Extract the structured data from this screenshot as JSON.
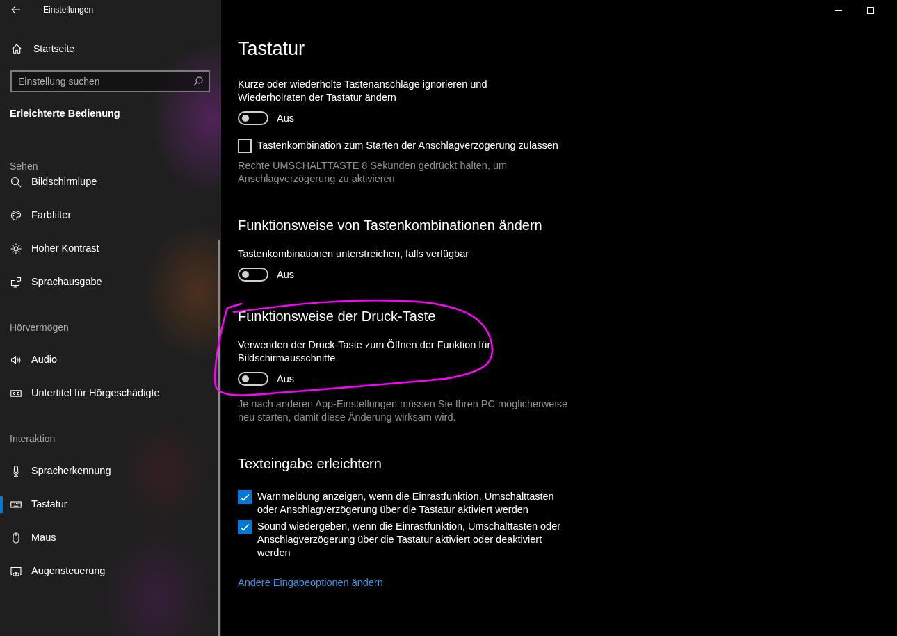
{
  "window": {
    "title": "Einstellungen"
  },
  "sidebar": {
    "home": "Startseite",
    "search": {
      "placeholder": "Einstellung suchen"
    },
    "category": "Erleichterte Bedienung",
    "groups": [
      {
        "heading": "Sehen",
        "items": [
          {
            "label": "Bildschirmlupe",
            "selected": false
          },
          {
            "label": "Farbfilter",
            "selected": false
          },
          {
            "label": "Hoher Kontrast",
            "selected": false
          },
          {
            "label": "Sprachausgabe",
            "selected": false
          }
        ]
      },
      {
        "heading": "Hörvermögen",
        "items": [
          {
            "label": "Audio",
            "selected": false
          },
          {
            "label": "Untertitel für Hörgeschädigte",
            "selected": false
          }
        ]
      },
      {
        "heading": "Interaktion",
        "items": [
          {
            "label": "Spracherkennung",
            "selected": false
          },
          {
            "label": "Tastatur",
            "selected": true
          },
          {
            "label": "Maus",
            "selected": false
          },
          {
            "label": "Augensteuerung",
            "selected": false
          }
        ]
      }
    ]
  },
  "page": {
    "title": "Tastatur",
    "sections": [
      {
        "circled": false,
        "controls": [
          {
            "kind": "toggle",
            "label": "Kurze oder wiederholte Tastenanschläge ignorieren und Wiederholraten der Tastatur ändern",
            "on": false,
            "state_label": "Aus"
          },
          {
            "kind": "checkbox",
            "label": "Tastenkombination zum Starten der Anschlagverzögerung zulassen",
            "checked": false
          },
          {
            "kind": "note",
            "text": "Rechte UMSCHALTTASTE 8 Sekunden gedrückt halten, um Anschlagverzögerung zu aktivieren"
          }
        ]
      },
      {
        "heading": "Funktionsweise von Tastenkombinationen ändern",
        "circled": false,
        "controls": [
          {
            "kind": "toggle",
            "label": "Tastenkombinationen unterstreichen, falls verfügbar",
            "on": false,
            "state_label": "Aus"
          }
        ]
      },
      {
        "heading": "Funktionsweise der Druck-Taste",
        "circled": true,
        "controls": [
          {
            "kind": "toggle",
            "label": "Verwenden der Druck-Taste zum Öffnen der Funktion für Bildschirmausschnitte",
            "on": false,
            "state_label": "Aus"
          },
          {
            "kind": "note",
            "text": "Je nach anderen App-Einstellungen müssen Sie Ihren PC möglicherweise neu starten, damit diese Änderung wirksam wird."
          }
        ]
      },
      {
        "heading": "Texteingabe erleichtern",
        "circled": false,
        "controls": [
          {
            "kind": "checkbox",
            "label": "Warnmeldung anzeigen, wenn die Einrastfunktion, Umschalttasten oder Anschlagverzögerung über die Tastatur aktiviert werden",
            "checked": true
          },
          {
            "kind": "checkbox",
            "label": "Sound wiedergeben, wenn die Einrastfunktion, Umschalttasten oder Anschlagverzögerung über die Tastatur aktiviert oder deaktiviert werden",
            "checked": true
          },
          {
            "kind": "link",
            "text": "Andere Eingabeoptionen ändern"
          }
        ]
      }
    ]
  }
}
